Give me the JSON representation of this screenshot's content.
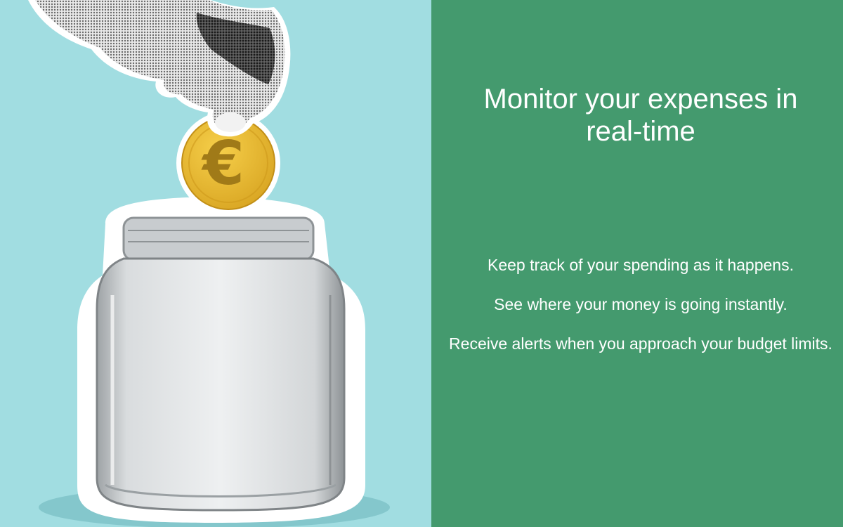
{
  "illustration": {
    "hand": "hand-icon",
    "coin": "euro-coin-icon",
    "coin_symbol": "€",
    "jar": "glass-jar-icon"
  },
  "colors": {
    "left_background": "#a1dde1",
    "right_background": "#449a6e",
    "text": "#ffffff",
    "coin": "#e9b62c",
    "coin_symbol": "#a07a18"
  },
  "slide": {
    "headline": "Monitor your expenses in real-time",
    "points": [
      "Keep track of your spending as it happens.",
      "See where your money is going instantly.",
      "Receive alerts when you approach your budget limits."
    ]
  }
}
